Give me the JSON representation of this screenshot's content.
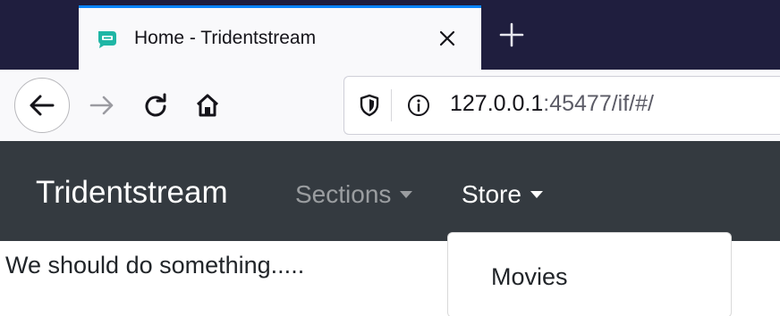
{
  "browser": {
    "tab": {
      "title": "Home - Tridentstream",
      "favicon": "tridentstream-logo-icon"
    },
    "toolbar": {
      "back_icon": "back-arrow-icon",
      "forward_icon": "forward-arrow-icon",
      "reload_icon": "reload-icon",
      "home_icon": "home-icon"
    },
    "url": {
      "host": "127.0.0.1",
      "rest": ":45477/if/#/"
    },
    "colors": {
      "tabstrip": "#1f1e3e",
      "tab_accent": "#0a84ff",
      "toolbar": "#f9f9fb"
    }
  },
  "app": {
    "brand": "Tridentstream",
    "nav": [
      {
        "label": "Sections",
        "state": "inactive"
      },
      {
        "label": "Store",
        "state": "active"
      }
    ],
    "colors": {
      "navbar": "#343a40"
    }
  },
  "content": {
    "text": "We should do something....."
  },
  "dropdown": {
    "items": [
      {
        "label": "Movies"
      }
    ]
  }
}
